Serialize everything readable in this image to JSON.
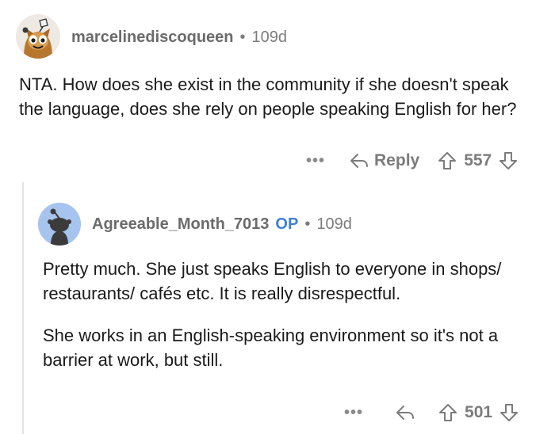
{
  "comments": [
    {
      "username": "marcelinediscoqueen",
      "age": "109d",
      "op_badge": "",
      "paragraphs": [
        "NTA. How does she exist in the community if she doesn't speak the language, does she rely on people speaking English for her?"
      ],
      "more_label": "•••",
      "reply_label": "Reply",
      "score": "557"
    },
    {
      "username": "Agreeable_Month_7013",
      "age": "109d",
      "op_badge": "OP",
      "paragraphs": [
        "Pretty much. She just speaks English to everyone in shops/ restaurants/ cafés etc. It is really disrespectful.",
        "She works in an English-speaking environment so it's not a barrier at work, but still."
      ],
      "more_label": "•••",
      "reply_label": "",
      "score": "501"
    }
  ],
  "separator": "•",
  "icons": {
    "avatar_1": "cartoon-character-avatar-icon",
    "avatar_2": "snoo-avatar-icon",
    "reply": "reply-arrow-icon",
    "upvote": "upvote-arrow-icon",
    "downvote": "downvote-arrow-icon",
    "more": "more-options-icon"
  },
  "colors": {
    "op_badge": "#3d7fd6",
    "meta_text": "#7c7c7c",
    "body_text": "#1a1a1b",
    "snoo_background": "#a7c4ee"
  }
}
